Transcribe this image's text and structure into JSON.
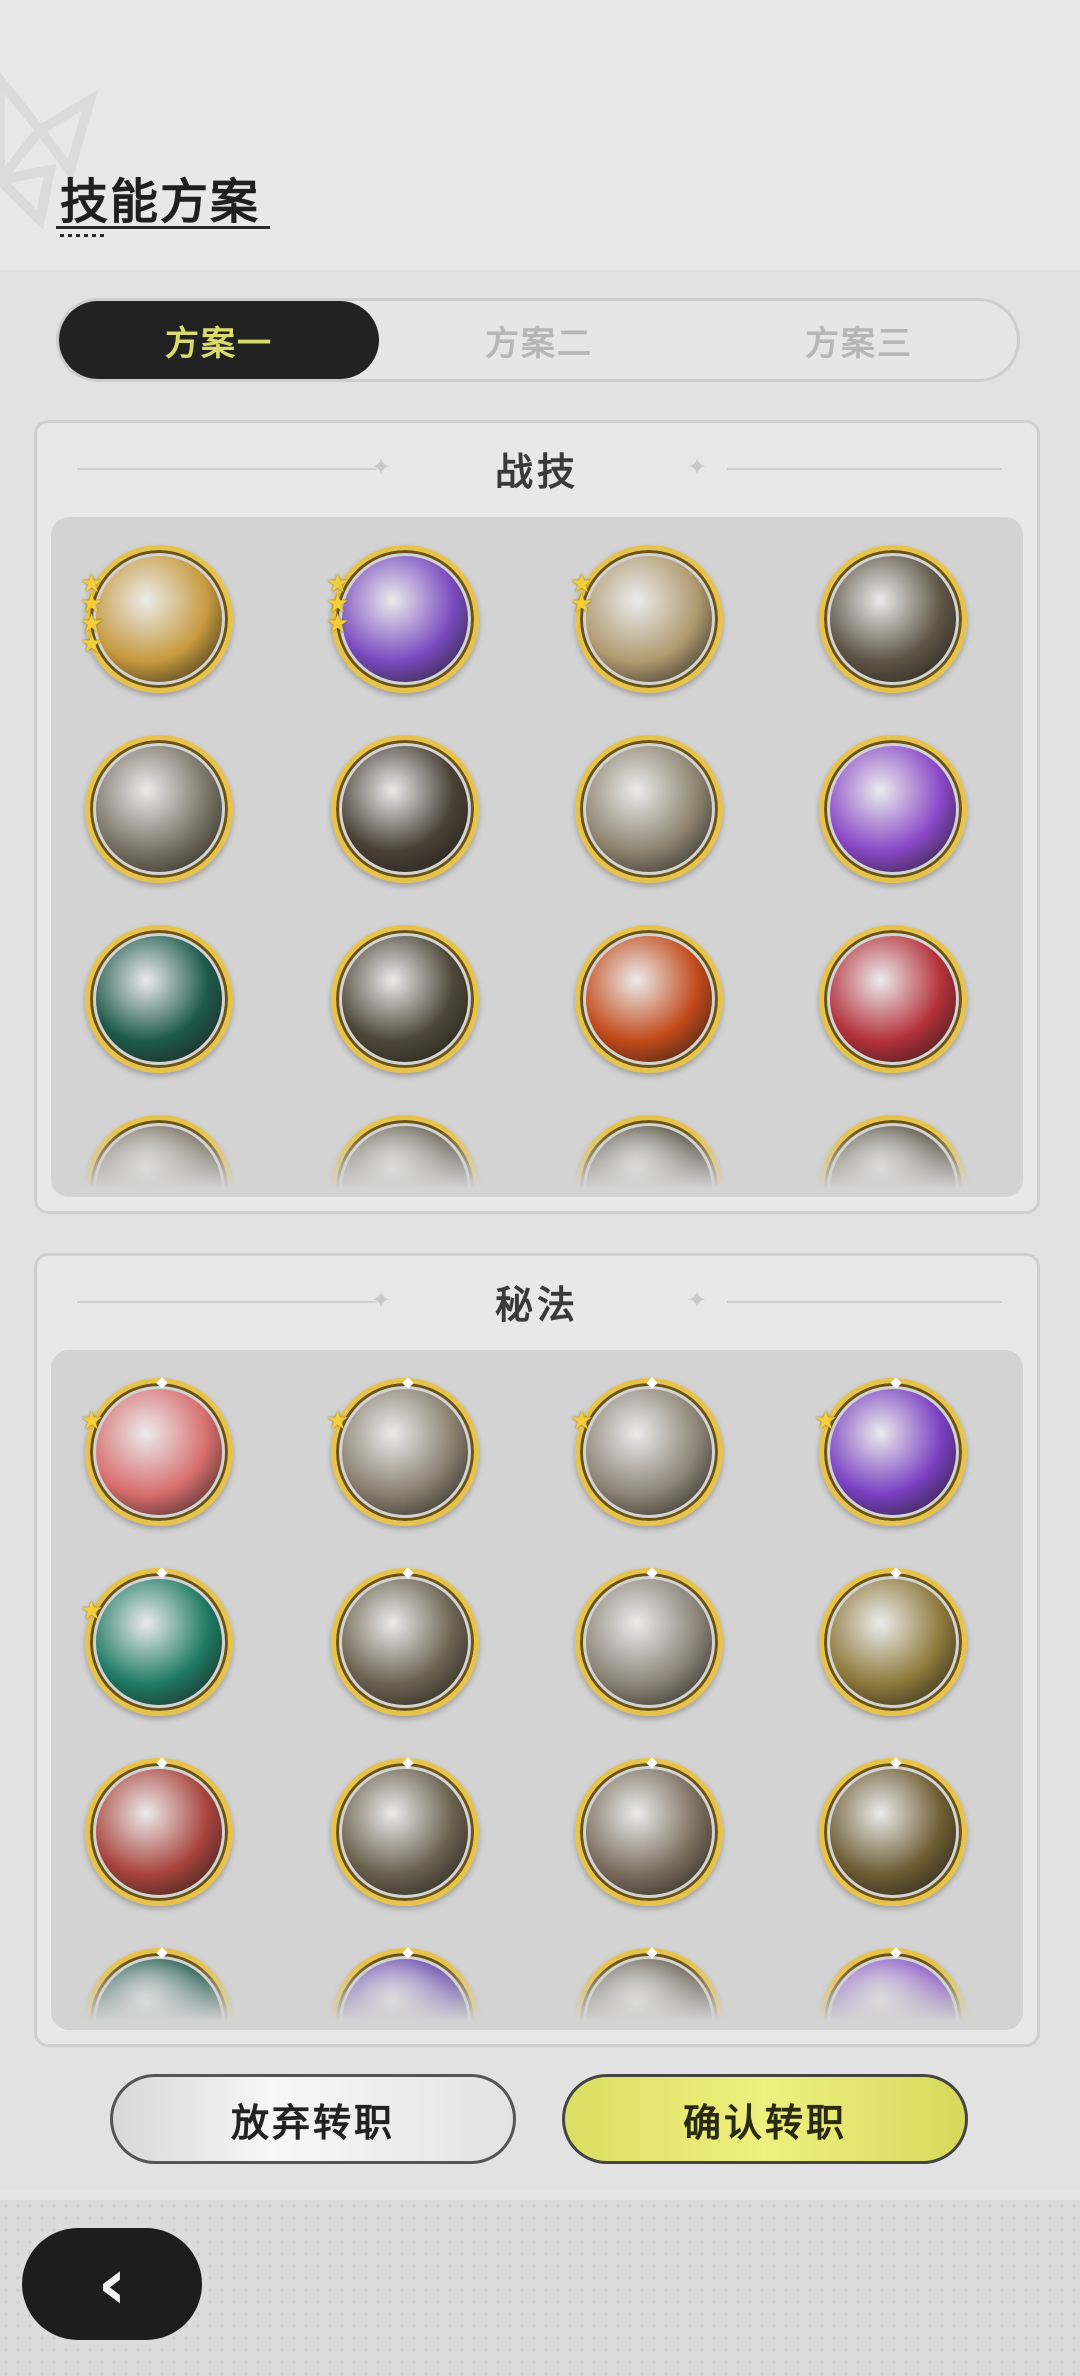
{
  "header": {
    "title": "技能方案"
  },
  "tabs": [
    {
      "label": "方案一",
      "active": true
    },
    {
      "label": "方案二",
      "active": false
    },
    {
      "label": "方案三",
      "active": false
    }
  ],
  "sections": [
    {
      "title": "战技",
      "skills": [
        {
          "name": "golden-swirl-icon",
          "stars": 4,
          "color": "#c79a3e"
        },
        {
          "name": "purple-claw-icon",
          "stars": 3,
          "color": "#7a4bc0"
        },
        {
          "name": "light-sword-icon",
          "stars": 2,
          "color": "#b09a70"
        },
        {
          "name": "wind-slash-icon",
          "stars": 0,
          "color": "#5f5546"
        },
        {
          "name": "whirl-arrow-icon",
          "stars": 0,
          "color": "#7b7366"
        },
        {
          "name": "burst-icon",
          "stars": 0,
          "color": "#4a4036"
        },
        {
          "name": "tornado-icon",
          "stars": 0,
          "color": "#8e8470"
        },
        {
          "name": "heart-shield-icon",
          "stars": 0,
          "color": "#8a48c8"
        },
        {
          "name": "green-slash-icon",
          "stars": 0,
          "color": "#1e5a4c"
        },
        {
          "name": "ground-spike-icon",
          "stars": 0,
          "color": "#4e4638"
        },
        {
          "name": "fire-emblem-icon",
          "stars": 0,
          "color": "#c24a1a"
        },
        {
          "name": "red-warrior-icon",
          "stars": 0,
          "color": "#b4303a"
        },
        {
          "name": "skill-13-icon",
          "stars": 0,
          "color": "#7a7060"
        },
        {
          "name": "skill-14-icon",
          "stars": 0,
          "color": "#6a6254"
        },
        {
          "name": "skill-15-icon",
          "stars": 0,
          "color": "#5a5244"
        },
        {
          "name": "skill-16-icon",
          "stars": 0,
          "color": "#5c5446"
        }
      ]
    },
    {
      "title": "秘法",
      "skills": [
        {
          "name": "red-sword-icon",
          "stars": 1,
          "color": "#d86e6e"
        },
        {
          "name": "leaf-icon",
          "stars": 1,
          "color": "#8a8070"
        },
        {
          "name": "dagger-icon",
          "stars": 1,
          "color": "#8f8578"
        },
        {
          "name": "purple-flame-icon",
          "stars": 1,
          "color": "#7a40c2"
        },
        {
          "name": "heal-plus-icon",
          "stars": 1,
          "color": "#1f7a66"
        },
        {
          "name": "eye-icon",
          "stars": 0,
          "color": "#6c6250"
        },
        {
          "name": "blade-icon",
          "stars": 0,
          "color": "#8e857a"
        },
        {
          "name": "golden-armor-icon",
          "stars": 0,
          "color": "#8f7a3c"
        },
        {
          "name": "red-armor-icon",
          "stars": 0,
          "color": "#a8443c"
        },
        {
          "name": "gauntlet-icon",
          "stars": 0,
          "color": "#6a604e"
        },
        {
          "name": "heart-badge-icon",
          "stars": 0,
          "color": "#7c6e5e"
        },
        {
          "name": "golden-plate-icon",
          "stars": 0,
          "color": "#6e5d34"
        },
        {
          "name": "arcane-13-icon",
          "stars": 0,
          "color": "#1e5a4c"
        },
        {
          "name": "arcane-14-icon",
          "stars": 0,
          "color": "#6a48b0"
        },
        {
          "name": "arcane-15-icon",
          "stars": 0,
          "color": "#6a6254"
        },
        {
          "name": "arcane-16-icon",
          "stars": 0,
          "color": "#8a58c8"
        }
      ]
    }
  ],
  "buttons": {
    "cancel": "放弃转职",
    "confirm": "确认转职"
  },
  "nav": {
    "back_icon": "chevron-left-icon"
  }
}
